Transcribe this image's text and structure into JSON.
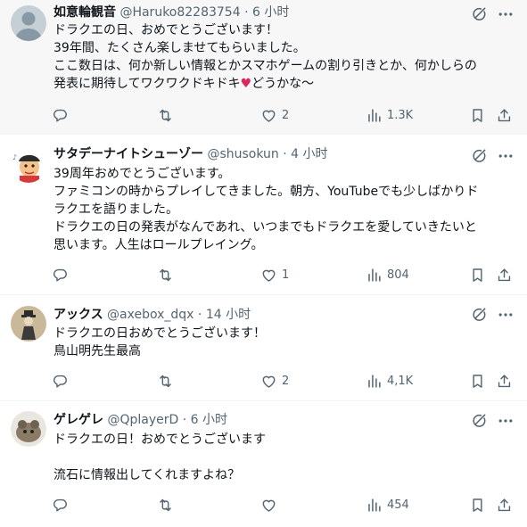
{
  "tweets": [
    {
      "name": "如意輪観音",
      "handle": "@Haruko82283754",
      "dot": "·",
      "time": "6 小时",
      "lines": [
        "ドラクエの日、おめでとうございます！",
        "39年間、たくさん楽しませてもらいました。",
        "ここ数日は、何か新しい情報とかスマホゲームの割り引きとか、何かしらの"
      ],
      "last_line_pre": "発表に期待してワクワクドキドキ",
      "last_line_emoji": "♥",
      "last_line_post": "どうかな〜",
      "replies": "",
      "retweets": "",
      "likes": "2",
      "views": "1.3K"
    },
    {
      "name": "サタデーナイトシューゾー",
      "handle": "@shusokun",
      "dot": "·",
      "time": "4 小时",
      "lines": [
        "39周年おめでとうございます。",
        "ファミコンの時からプレイしてきました。朝方、YouTubeでも少しばかりド",
        "ラクエを語りました。",
        "ドラクエの日の発表がなんであれ、いつまでもドラクエを愛していきたいと",
        "思います。人生はロールプレイング。"
      ],
      "replies": "",
      "retweets": "",
      "likes": "1",
      "views": "804"
    },
    {
      "name": "アックス",
      "handle": "@axebox_dqx",
      "dot": "·",
      "time": "14 小时",
      "lines": [
        "ドラクエの日おめでとうございます！",
        "鳥山明先生最高"
      ],
      "replies": "",
      "retweets": "",
      "likes": "2",
      "views": "4,1K"
    },
    {
      "name": "ゲレゲレ",
      "handle": "@QplayerD",
      "dot": "·",
      "time": "6 小时",
      "lines": [
        "ドラクエの日！おめでとうございます",
        "",
        "流石に情報出してくれますよね？"
      ],
      "replies": "",
      "retweets": "",
      "likes": "",
      "views": "454"
    }
  ],
  "icons": {
    "reply": "reply-icon",
    "retweet": "retweet-icon",
    "like": "heart-icon",
    "views": "views-icon",
    "bookmark": "bookmark-icon",
    "share": "share-icon",
    "grok": "grok-icon",
    "more": "more-icon"
  },
  "colors": {
    "text": "#0f1419",
    "secondary": "#536471",
    "heart_emoji": "#e0245e",
    "highlight_bg": "#f7f7f7"
  }
}
